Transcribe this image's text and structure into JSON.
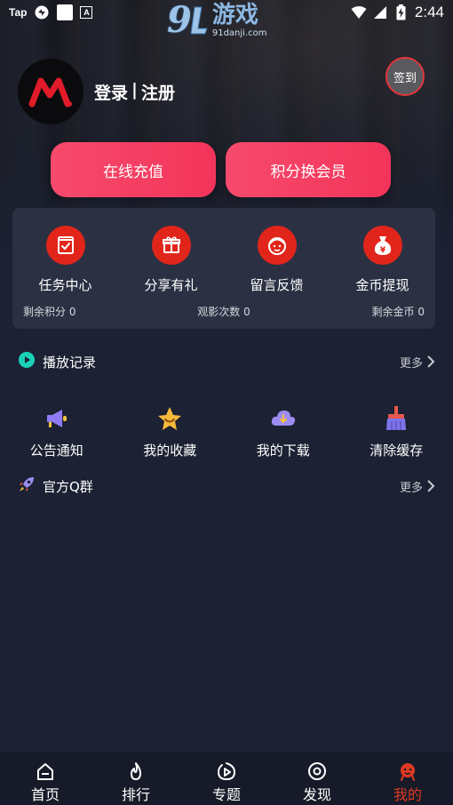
{
  "status_bar": {
    "left_text": "Tap",
    "time": "2:44",
    "icons": [
      "sync-icon",
      "notification-square-icon",
      "a-icon",
      "wifi-icon",
      "signal-icon",
      "battery-charging-icon"
    ]
  },
  "watermark": {
    "number": "9",
    "title": "游戏",
    "url": "91danji.com"
  },
  "profile": {
    "login_label": "登录",
    "separator": "|",
    "register_label": "注册",
    "signin_label": "签到"
  },
  "actions": {
    "recharge_label": "在线充值",
    "exchange_vip_label": "积分换会员"
  },
  "quick_menu": [
    {
      "label": "任务中心",
      "icon": "task-icon"
    },
    {
      "label": "分享有礼",
      "icon": "gift-icon"
    },
    {
      "label": "留言反馈",
      "icon": "feedback-icon"
    },
    {
      "label": "金币提现",
      "icon": "money-bag-icon"
    }
  ],
  "stats": {
    "points_remaining": "剩余积分 0",
    "views_count": "观影次数 0",
    "coins_remaining": "剩余金币 0"
  },
  "history": {
    "title": "播放记录",
    "more": "更多"
  },
  "tools": [
    {
      "label": "公告通知",
      "icon": "megaphone-icon"
    },
    {
      "label": "我的收藏",
      "icon": "star-icon"
    },
    {
      "label": "我的下载",
      "icon": "cloud-download-icon"
    },
    {
      "label": "清除缓存",
      "icon": "broom-icon"
    }
  ],
  "qq_group": {
    "title": "官方Q群",
    "more": "更多"
  },
  "bottom_nav": [
    {
      "label": "首页",
      "icon": "home-icon"
    },
    {
      "label": "排行",
      "icon": "fire-icon"
    },
    {
      "label": "专题",
      "icon": "play-circle-icon"
    },
    {
      "label": "发现",
      "icon": "discover-icon"
    },
    {
      "label": "我的",
      "icon": "profile-icon",
      "active": true
    }
  ],
  "colors": {
    "background": "#1c2133",
    "accent_red": "#e1251b",
    "button_gradient_start": "#f64a6c",
    "button_gradient_end": "#f3345a",
    "card": "#2b3143",
    "nav_active": "#e13a22"
  }
}
